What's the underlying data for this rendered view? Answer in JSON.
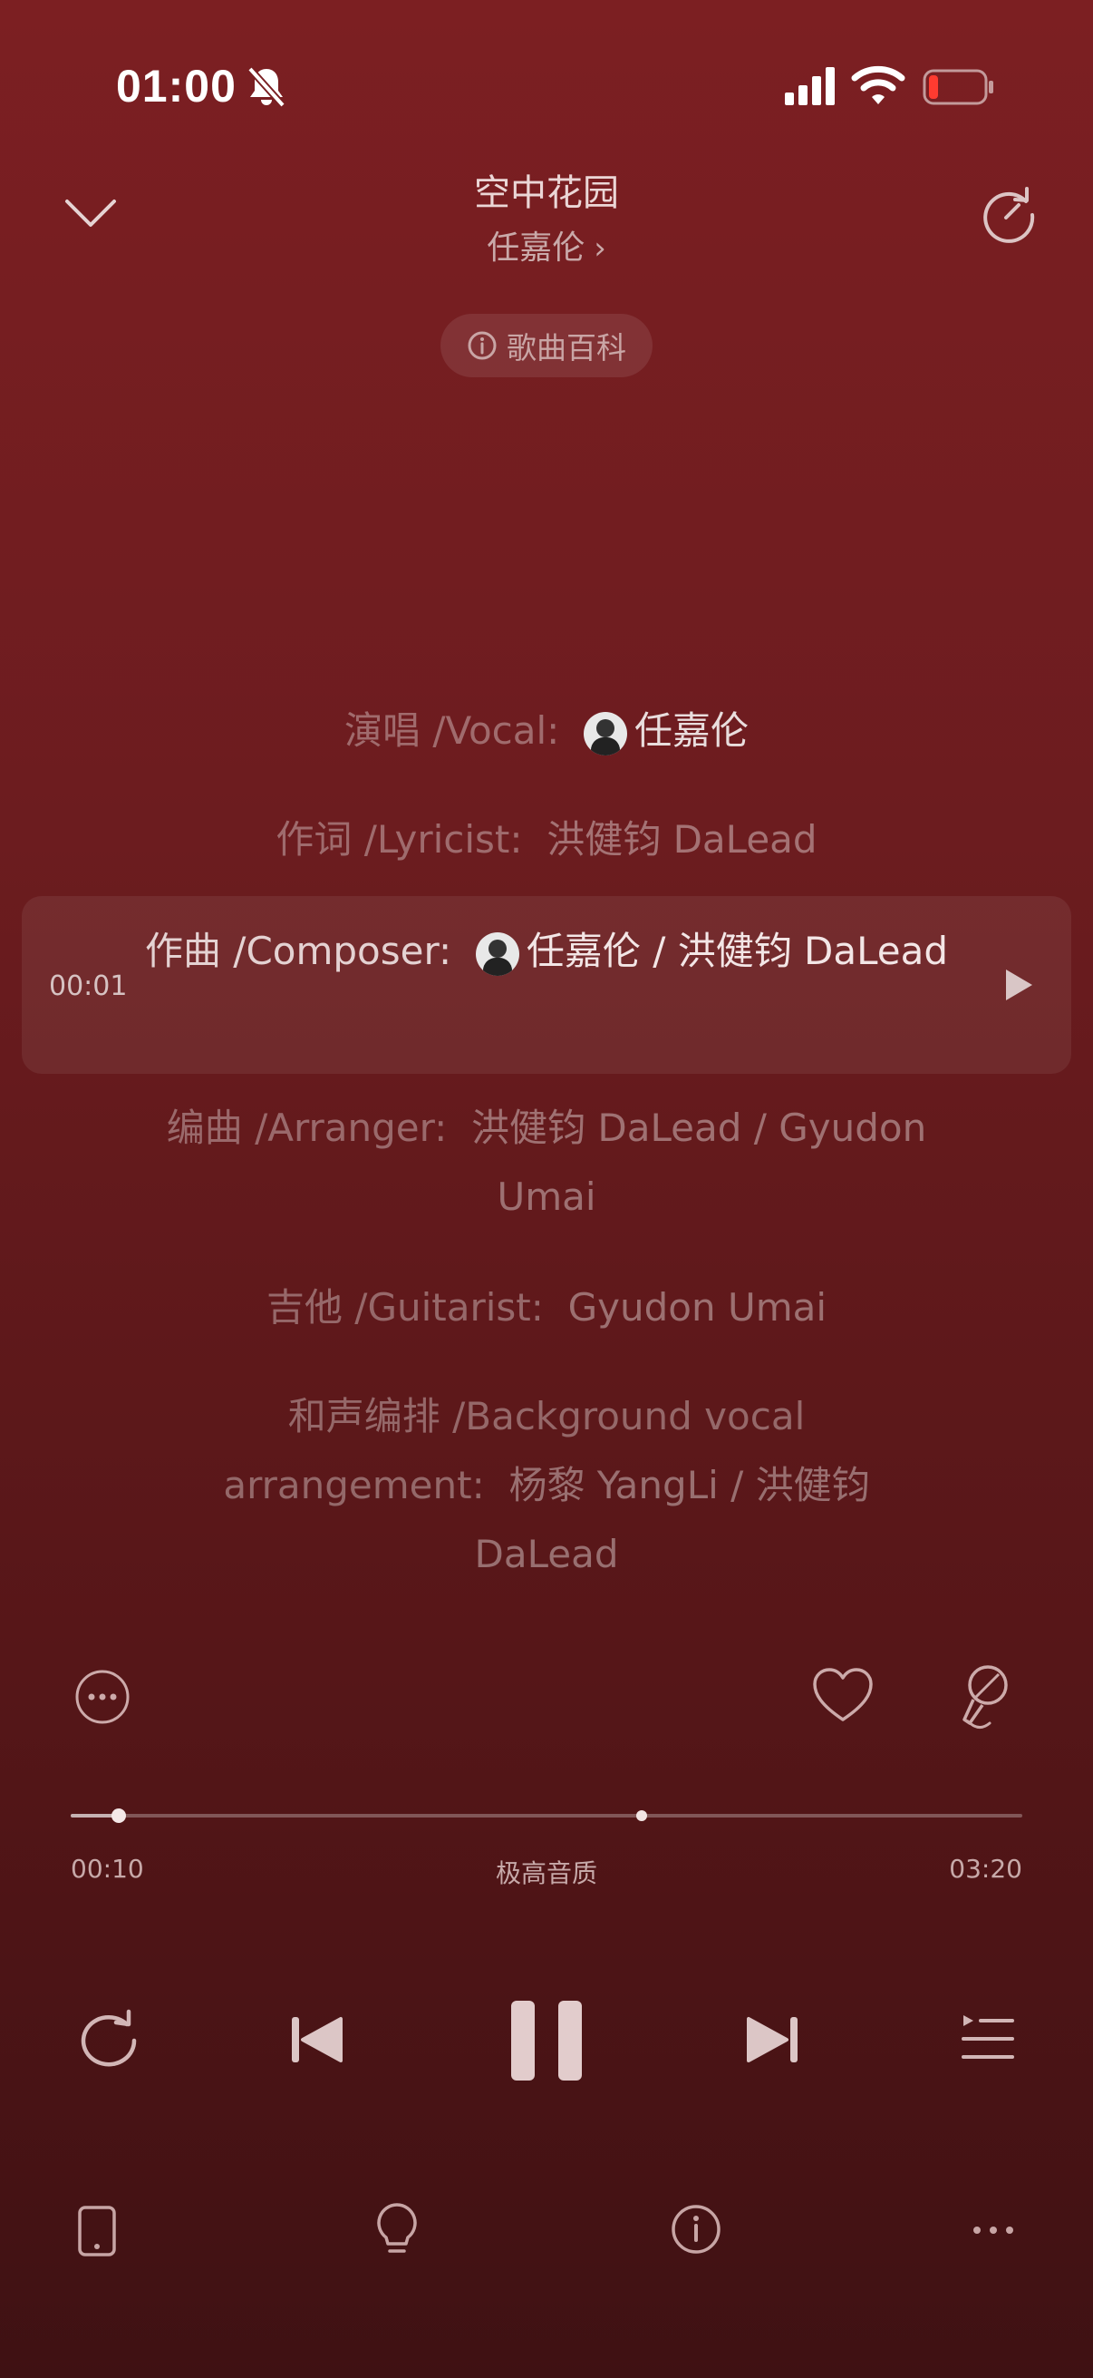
{
  "status_bar": {
    "time": "01:00",
    "icons": [
      "bell-muted-icon",
      "cellular-signal-icon",
      "wifi-icon",
      "battery-low-icon"
    ],
    "battery_color": "#ff3b30"
  },
  "header": {
    "title": "空中花园",
    "artist": "任嘉伦",
    "artist_chevron": "›",
    "wiki_label": "歌曲百科"
  },
  "credits": [
    {
      "role": "演唱 /Vocal:",
      "names": "任嘉伦",
      "avatar": true
    },
    {
      "role": "作词 /Lyricist:",
      "names": "洪健钧 DaLead",
      "avatar": false
    },
    {
      "role": "作曲 /Composer:",
      "names": "任嘉伦  /  洪健钧 DaLead",
      "avatar": true
    },
    {
      "role": "编曲 /Arranger:",
      "names": "洪健钧 DaLead  /  Gyudon Umai",
      "avatar": false
    },
    {
      "role": "吉他 /Guitarist:",
      "names": "Gyudon Umai",
      "avatar": false
    },
    {
      "role": "和声编排 /Background vocal arrangement:",
      "names": "杨黎 YangLi  /  洪健钧 DaLead",
      "avatar": false
    }
  ],
  "active_line": {
    "timestamp": "00:01",
    "index": 2
  },
  "player": {
    "elapsed": "00:10",
    "total": "03:20",
    "quality": "极高音质",
    "progress": 0.05,
    "marker": 0.6
  },
  "colors": {
    "background_top": "#7c1f22",
    "background_bottom": "#3f1113"
  }
}
